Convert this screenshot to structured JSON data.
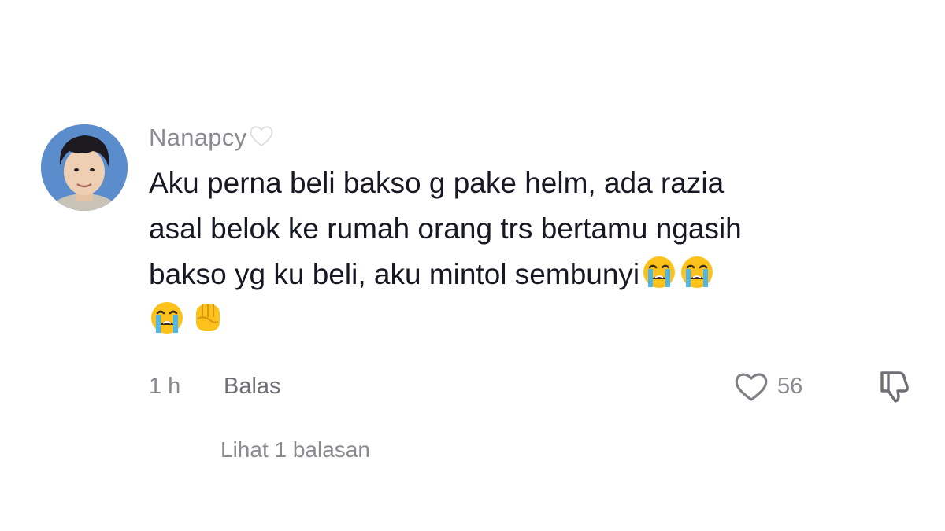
{
  "comment": {
    "username": "Nanapcy",
    "username_badge": "white-heart-icon",
    "text_lines": [
      "Aku perna beli bakso g pake helm, ada razia",
      "asal belok ke rumah orang trs bertamu ngasih",
      "bakso yg ku beli, aku mintol sembunyi"
    ],
    "line3_emojis": [
      "crying-face-icon",
      "crying-face-icon"
    ],
    "trailing_emojis": [
      "crying-face-icon",
      "raised-fist-icon"
    ],
    "timestamp": "1 h",
    "reply_label": "Balas",
    "like_count": "56",
    "view_replies_label": "Lihat 1 balasan"
  },
  "colors": {
    "primary_text": "#161823",
    "secondary_text": "#8a8b91"
  }
}
